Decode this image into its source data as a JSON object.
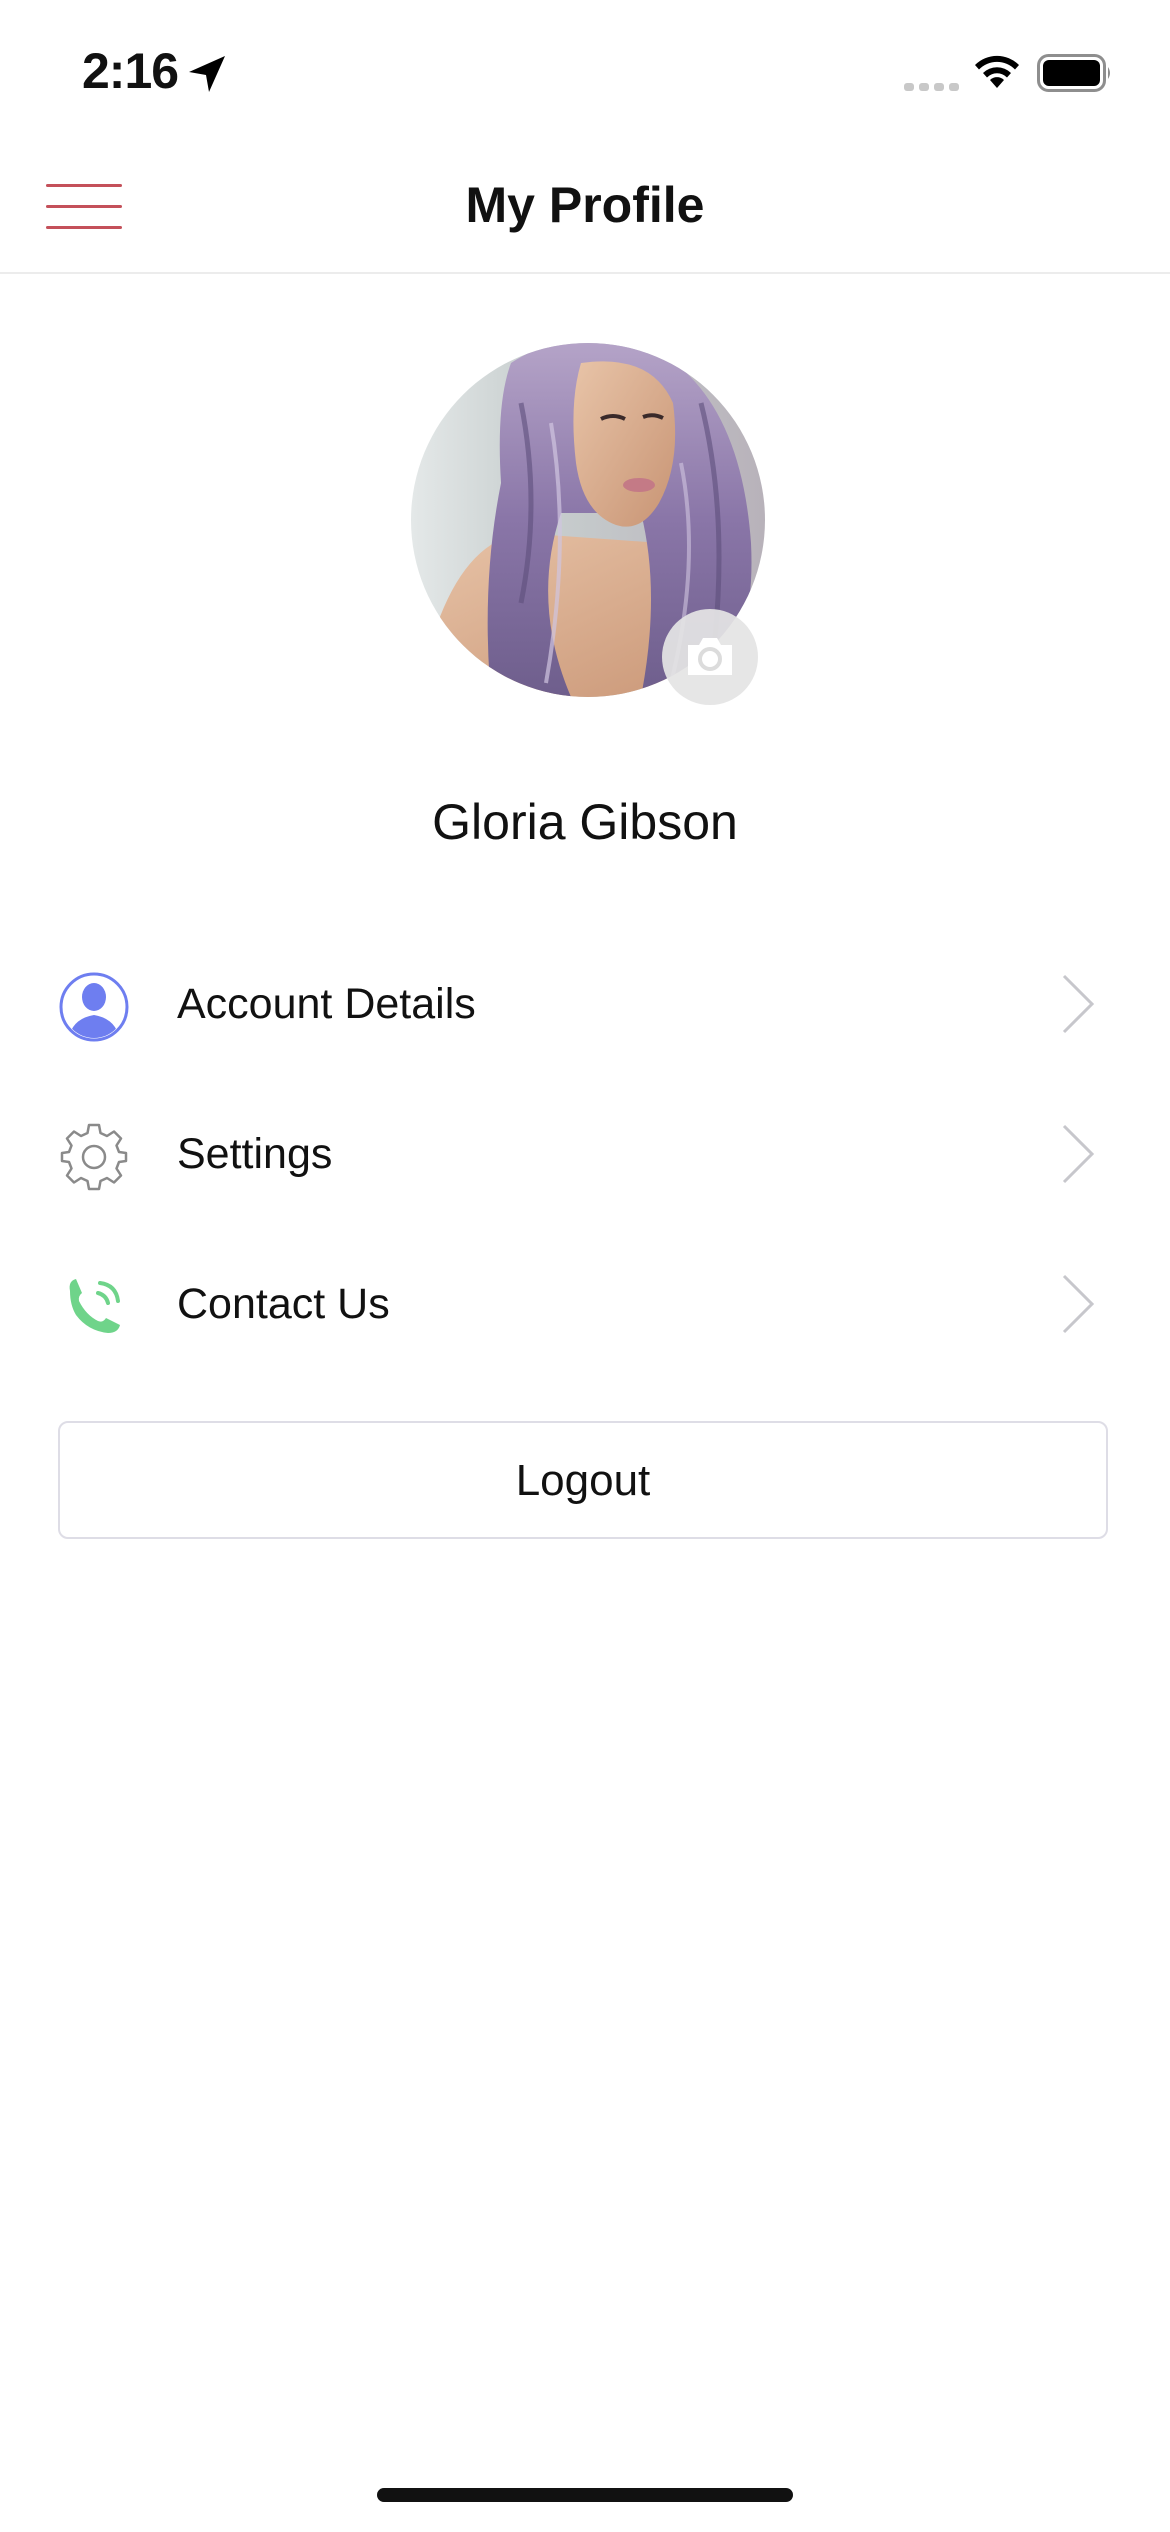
{
  "status_bar": {
    "time": "2:16",
    "icons": [
      "location-arrow-icon",
      "cellular-signal-icon",
      "wifi-icon",
      "battery-icon"
    ]
  },
  "nav": {
    "title": "My Profile",
    "menu_icon": "hamburger-menu-icon",
    "menu_color": "#c4505a"
  },
  "profile": {
    "name": "Gloria Gibson",
    "avatar_icon": "profile-photo",
    "edit_photo_icon": "camera-icon"
  },
  "menu": {
    "items": [
      {
        "label": "Account Details",
        "icon": "user-icon",
        "color": "#6e7ef0"
      },
      {
        "label": "Settings",
        "icon": "gear-icon",
        "color": "#8a8a8a"
      },
      {
        "label": "Contact Us",
        "icon": "phone-icon",
        "color": "#6fd48a"
      }
    ],
    "chevron_icon": "chevron-right-icon"
  },
  "logout": {
    "label": "Logout"
  }
}
